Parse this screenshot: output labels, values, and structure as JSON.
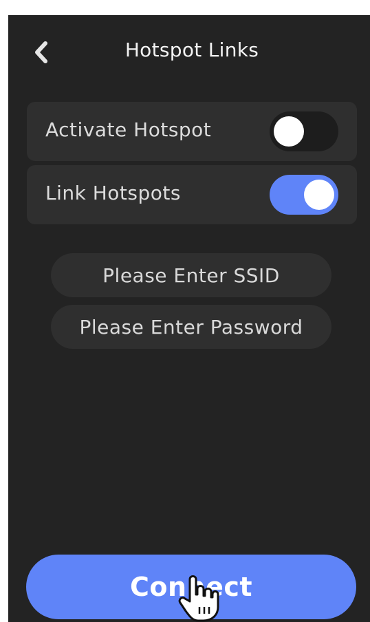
{
  "header": {
    "title": "Hotspot Links",
    "back_icon": "chevron-left-icon"
  },
  "settings": {
    "rows": [
      {
        "label": "Activate Hotspot",
        "toggle_state": "off"
      },
      {
        "label": "Link Hotspots",
        "toggle_state": "on"
      }
    ]
  },
  "form": {
    "ssid_placeholder": "Please Enter SSID",
    "password_placeholder": "Please Enter Password"
  },
  "actions": {
    "connect_label": "Connect"
  },
  "colors": {
    "background": "#232323",
    "row_background": "#2f2f2f",
    "accent": "#5f84f8",
    "text": "#dcdcdc"
  },
  "cursor_icon": "hand-pointer-icon"
}
